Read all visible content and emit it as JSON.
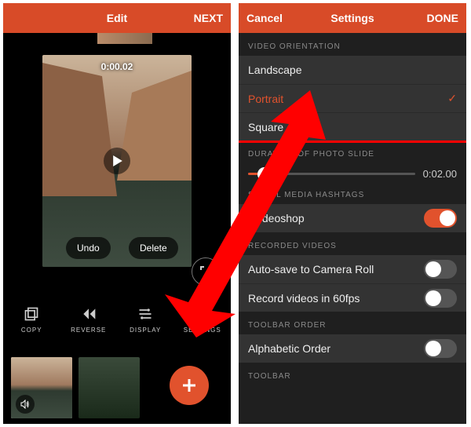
{
  "edit": {
    "header": {
      "title": "Edit",
      "next": "NEXT"
    },
    "timestamp": "0:00.02",
    "undo": "Undo",
    "delete": "Delete",
    "toolbar": [
      {
        "label": "COPY"
      },
      {
        "label": "REVERSE"
      },
      {
        "label": "DISPLAY"
      },
      {
        "label": "SETTINGS"
      }
    ]
  },
  "settings": {
    "header": {
      "cancel": "Cancel",
      "title": "Settings",
      "done": "DONE"
    },
    "orientation": {
      "heading": "VIDEO ORIENTATION",
      "options": [
        "Landscape",
        "Portrait",
        "Square"
      ],
      "selected": "Portrait"
    },
    "duration": {
      "heading": "DURATION OF PHOTO SLIDE",
      "value": "0:02.00"
    },
    "hashtags": {
      "heading": "SOCIAL MEDIA HASHTAGS",
      "label": "#videoshop",
      "on": true
    },
    "recorded": {
      "heading": "RECORDED VIDEOS",
      "rows": [
        {
          "label": "Auto-save to Camera Roll",
          "on": false
        },
        {
          "label": "Record videos in 60fps",
          "on": false
        }
      ]
    },
    "toolbar_order": {
      "heading": "TOOLBAR ORDER",
      "label": "Alphabetic Order",
      "on": false
    },
    "toolbar_heading": "TOOLBAR"
  }
}
